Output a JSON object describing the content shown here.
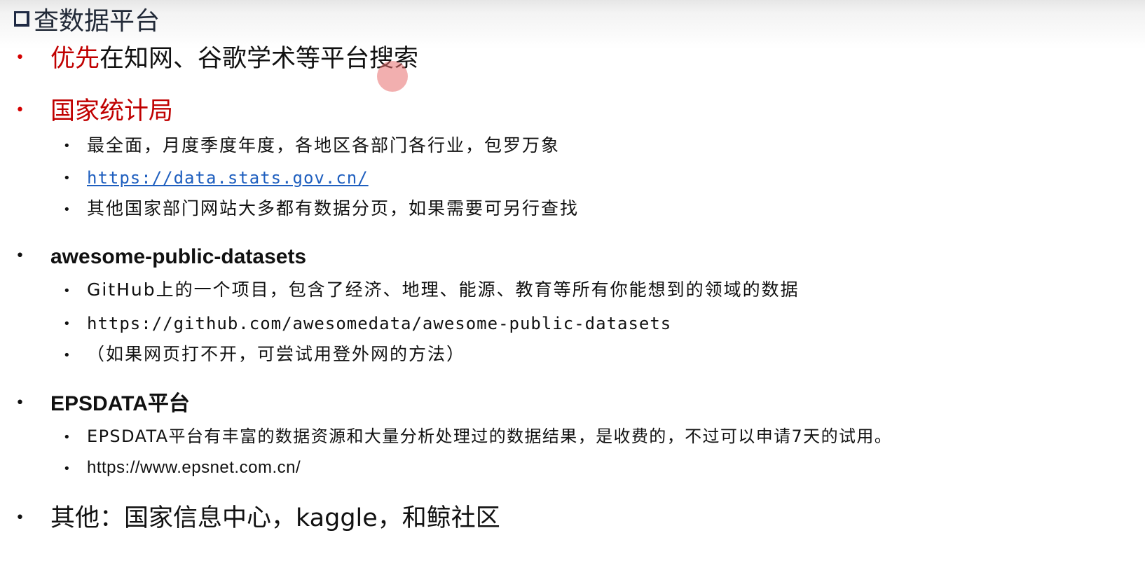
{
  "title": "查数据平台",
  "items": [
    {
      "prefix": "优先",
      "text": "在知网、谷歌学术等平台搜索"
    },
    {
      "heading": "国家统计局",
      "subs": [
        "最全面，月度季度年度，各地区各部门各行业，包罗万象",
        "https://data.stats.gov.cn/",
        "其他国家部门网站大多都有数据分页，如果需要可另行查找"
      ]
    },
    {
      "heading": "awesome-public-datasets",
      "subs": [
        "GitHub上的一个项目，包含了经济、地理、能源、教育等所有你能想到的领域的数据",
        "https://github.com/awesomedata/awesome-public-datasets",
        "（如果网页打不开，可尝试用登外网的方法）"
      ]
    },
    {
      "heading": "EPSDATA平台",
      "subs": [
        "EPSDATA平台有丰富的数据资源和大量分析处理过的数据结果，是收费的，不过可以申请7天的试用。",
        "https://www.epsnet.com.cn/"
      ]
    },
    {
      "heading": "其他：国家信息中心，kaggle，和鲸社区"
    }
  ],
  "colors": {
    "accent_red": "#c00000",
    "link_blue": "#1f5fbf"
  }
}
